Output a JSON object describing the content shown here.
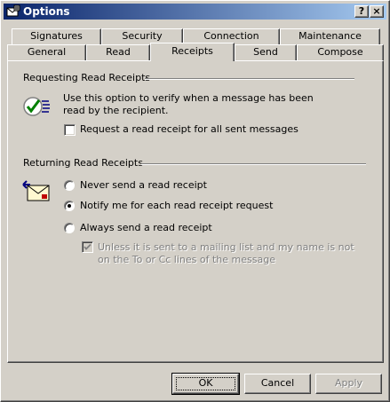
{
  "window": {
    "title": "Options",
    "help_btn": "?",
    "close_btn": "×"
  },
  "tabs_back": [
    "Signatures",
    "Security",
    "Connection",
    "Maintenance"
  ],
  "tabs_front": [
    "General",
    "Read",
    "Receipts",
    "Send",
    "Compose"
  ],
  "selected_tab": "Receipts",
  "requesting": {
    "label": "Requesting Read Receipts",
    "description": "Use this option to verify when a message has been read by the recipient.",
    "checkbox_label": "Request a read receipt for all sent messages",
    "checked": false
  },
  "returning": {
    "label": "Returning Read Receipts",
    "options": [
      {
        "label": "Never send a read receipt",
        "selected": false
      },
      {
        "label": "Notify me for each read receipt request",
        "selected": true
      },
      {
        "label": "Always send a read receipt",
        "selected": false
      }
    ],
    "sub_checkbox_label": "Unless it is sent to a mailing list and my name is not on the To or Cc lines of the message",
    "sub_checked": true,
    "sub_enabled": false
  },
  "buttons": {
    "ok": "OK",
    "cancel": "Cancel",
    "apply": "Apply"
  },
  "icons": {
    "app": "mail-options-icon",
    "requesting": "read-receipt-check-icon",
    "returning": "return-receipt-envelope-icon"
  },
  "colors": {
    "titlebar_start": "#0a246a",
    "titlebar_end": "#a6caf0",
    "face": "#d4d0c8"
  }
}
